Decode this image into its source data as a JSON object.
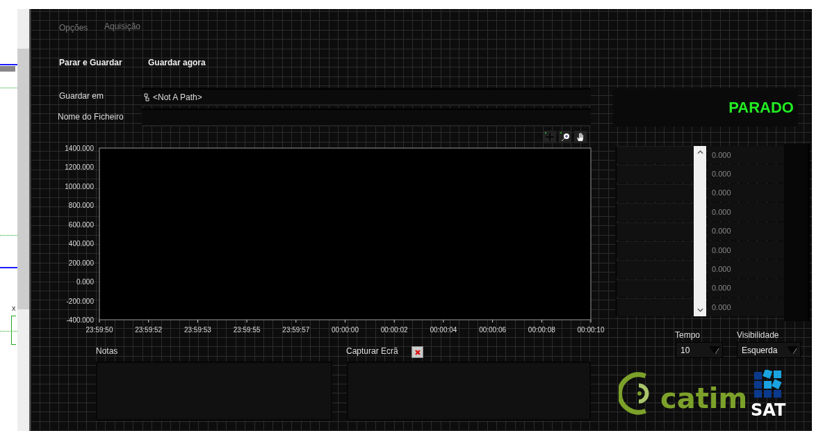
{
  "left_strip": {
    "label": "x"
  },
  "menu": [
    {
      "label": "Opções"
    },
    {
      "label": "Aquisição"
    }
  ],
  "buttons": [
    "Parar e Guardar",
    "Guardar agora"
  ],
  "path_field": {
    "label": "Guardar em",
    "value": "<Not A Path>"
  },
  "filename_field": {
    "label": "Nome do Ficheiro"
  },
  "status": {
    "text": "PARADO",
    "color": "#22ee22"
  },
  "chart": {
    "chart_data": {
      "type": "line",
      "x": [
        "23:59:50",
        "23:59:52",
        "23:59:53",
        "23:59:55",
        "23:59:57",
        "00:00:00",
        "00:00:02",
        "00:00:04",
        "00:00:06",
        "00:00:08",
        "00:00:10"
      ],
      "ylim": [
        -400,
        1400
      ],
      "yticks": [
        {
          "value": 1400,
          "label": "1400.000"
        },
        {
          "value": 1200,
          "label": "1200.000"
        },
        {
          "value": 1000,
          "label": "1000.000"
        },
        {
          "value": 800,
          "label": "800.000"
        },
        {
          "value": 600,
          "label": "600.000"
        },
        {
          "value": 400,
          "label": "400.000"
        },
        {
          "value": 200,
          "label": "200.000"
        },
        {
          "value": 0,
          "label": "0.000"
        },
        {
          "value": -200,
          "label": "-200.000"
        },
        {
          "value": -400,
          "label": "-400.000"
        }
      ]
    }
  },
  "values": [
    "0.000",
    "0.000",
    "0.000",
    "0.000",
    "0.000",
    "0.000",
    "0.000",
    "0.000",
    "0.000"
  ],
  "tempo": {
    "label": "Tempo",
    "value": "10"
  },
  "visibilidade": {
    "label": "Visibilidade",
    "value": "Esquerda"
  },
  "notes": {
    "label": "Notas"
  },
  "capture": {
    "label": "Capturar Ecrã"
  },
  "logos": {
    "catim": "catim",
    "sat": "SAT"
  }
}
